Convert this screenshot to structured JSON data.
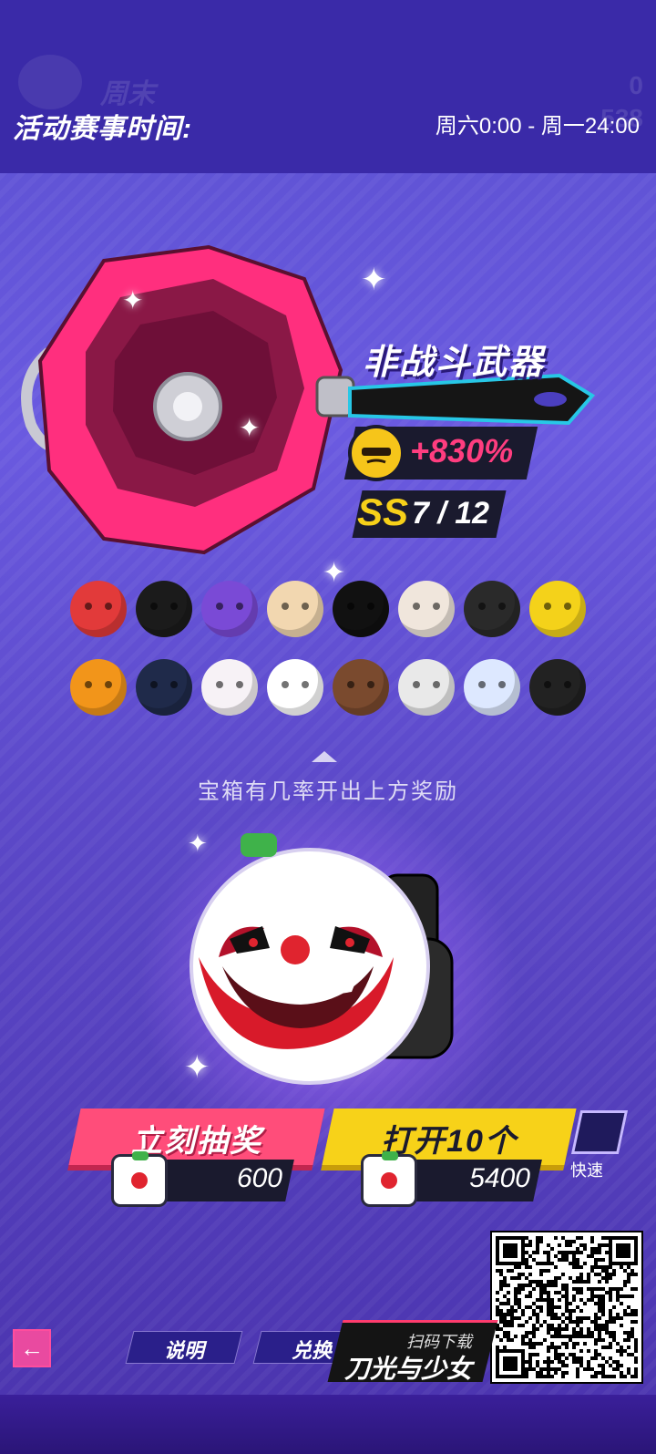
{
  "header": {
    "ghost_title": "周末",
    "ghost_counter_top": "0",
    "ghost_counter_bottom": "538",
    "event_label": "活动赛事时间:",
    "event_time": "周六0:00 - 周一24:00"
  },
  "item": {
    "type_label": "非战斗武器",
    "bonus_value": "+830%",
    "rank": "SS",
    "rank_count": "7 / 12",
    "pan_color": "#ff2f7e"
  },
  "rewards": [
    {
      "icon": "nutcracker-head-icon",
      "color": "#e23a3a"
    },
    {
      "icon": "angel-bob-hair-icon",
      "color": "#1b1b1b"
    },
    {
      "icon": "robot-helmet-icon",
      "color": "#7a4ad6"
    },
    {
      "icon": "blonde-hair-icon",
      "color": "#f2d7b0"
    },
    {
      "icon": "black-bunny-head-icon",
      "color": "#111111"
    },
    {
      "icon": "goat-skull-icon",
      "color": "#f0e6dc"
    },
    {
      "icon": "black-orange-helmet-icon",
      "color": "#2a2a2a"
    },
    {
      "icon": "lego-head-icon",
      "color": "#f4d21a"
    },
    {
      "icon": "pumpkin-head-icon",
      "color": "#f2951a"
    },
    {
      "icon": "blue-knight-helmet-icon",
      "color": "#1f2a4a"
    },
    {
      "icon": "white-bunny-head-icon",
      "color": "#f7f2f6"
    },
    {
      "icon": "clown-head-icon",
      "color": "#ffffff"
    },
    {
      "icon": "bear-head-icon",
      "color": "#7a4a2e"
    },
    {
      "icon": "box-head-icon",
      "color": "#e9e9e9"
    },
    {
      "icon": "fish-head-icon",
      "color": "#dde8ff"
    },
    {
      "icon": "grim-reaper-hood-icon",
      "color": "#222222"
    }
  ],
  "chest_hint": "宝箱有几率开出上方奖励",
  "actions": {
    "draw_now": "立刻抽奖",
    "draw_now_cost": "600",
    "open_ten": "打开10个",
    "open_ten_cost": "5400",
    "quick_label": "快速"
  },
  "footer": {
    "instructions": "说明",
    "exchange": "兑换",
    "promo_sub": "扫码下载",
    "promo_name": "刀光与少女"
  }
}
